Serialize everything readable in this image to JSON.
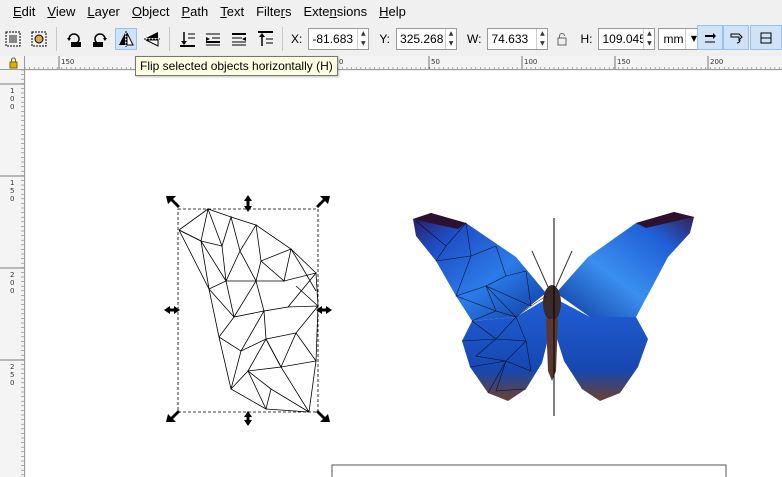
{
  "menu": [
    {
      "pre": "",
      "u": "E",
      "post": "dit"
    },
    {
      "pre": "",
      "u": "V",
      "post": "iew"
    },
    {
      "pre": "",
      "u": "L",
      "post": "ayer"
    },
    {
      "pre": "",
      "u": "O",
      "post": "bject"
    },
    {
      "pre": "",
      "u": "P",
      "post": "ath"
    },
    {
      "pre": "",
      "u": "T",
      "post": "ext"
    },
    {
      "pre": "Filte",
      "u": "r",
      "post": "s"
    },
    {
      "pre": "Exte",
      "u": "n",
      "post": "sions"
    },
    {
      "pre": "",
      "u": "H",
      "post": "elp"
    }
  ],
  "toolbar": {
    "x": {
      "label": "X:",
      "value": "-81.683"
    },
    "y": {
      "label": "Y:",
      "value": "325.268"
    },
    "w": {
      "label": "W:",
      "value": "74.633"
    },
    "h": {
      "label": "H:",
      "value": "109.045"
    },
    "unit": "mm",
    "icons": [
      "select-all-icon",
      "select-all-in-all-layers-icon",
      "rotate-ccw-icon",
      "rotate-cw-icon",
      "flip-horizontal-icon",
      "flip-vertical-icon",
      "lower-to-bottom-icon",
      "lower-icon",
      "raise-icon",
      "raise-to-top-icon",
      "scale-stroke-icon",
      "scale-corners-icon",
      "move-gradients-icon"
    ]
  },
  "tooltip": "Flip selected objects horizontally (H)",
  "rulers": {
    "h_labels": [
      "150",
      "100",
      "50",
      "0",
      "50",
      "100",
      "150",
      "200"
    ],
    "v_labels": [
      "100",
      "150",
      "200",
      "250"
    ]
  },
  "colors": {
    "butterfly_blue": "#1d5fd6",
    "selection_bg": "#cfe2f7"
  }
}
